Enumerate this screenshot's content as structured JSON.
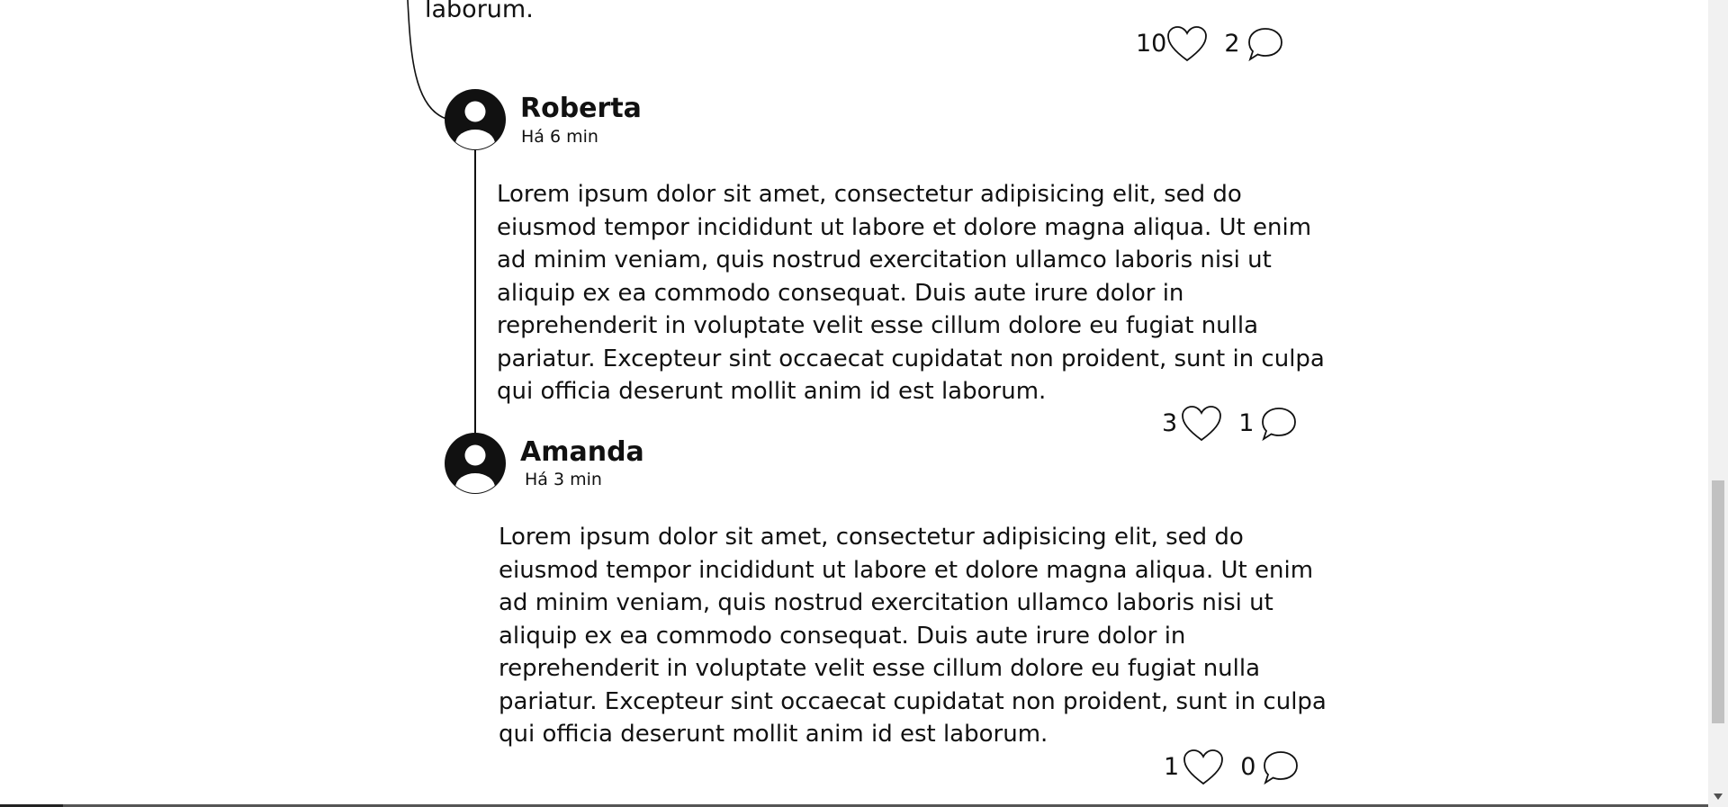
{
  "previous_comment": {
    "tail_text": "laborum.",
    "likes": "10",
    "replies": "2"
  },
  "comments": [
    {
      "author": "Roberta",
      "time": "Há 6 min",
      "text": "Lorem ipsum dolor sit amet, consectetur adipisicing elit, sed do eiusmod tempor incididunt ut labore et dolore magna aliqua. Ut enim ad minim veniam, quis nostrud exercitation ullamco laboris nisi ut aliquip ex ea commodo consequat. Duis aute irure dolor in reprehenderit in voluptate velit esse cillum dolore eu fugiat nulla pariatur. Excepteur sint occaecat cupidatat non proident, sunt in culpa qui officia deserunt mollit anim id est laborum.",
      "likes": "3",
      "replies": "1"
    },
    {
      "author": "Amanda",
      "time": "Há 3 min",
      "text": "Lorem ipsum dolor sit amet, consectetur adipisicing elit, sed do eiusmod tempor incididunt ut labore et dolore magna aliqua. Ut enim ad minim veniam, quis nostrud exercitation ullamco laboris nisi ut aliquip ex ea commodo consequat. Duis aute irure dolor in reprehenderit in voluptate velit esse cillum dolore eu fugiat nulla pariatur. Excepteur sint occaecat cupidatat non proident, sunt in culpa qui officia deserunt mollit anim id est laborum.",
      "likes": "1",
      "replies": "0"
    }
  ],
  "icons": {
    "avatar": "user-avatar-icon",
    "like": "heart-outline-icon",
    "reply": "speech-bubble-icon"
  },
  "colors": {
    "text": "#111111",
    "background": "#ffffff",
    "scrollbar_track": "#f1f1f1",
    "scrollbar_thumb": "#c1c1c1"
  }
}
